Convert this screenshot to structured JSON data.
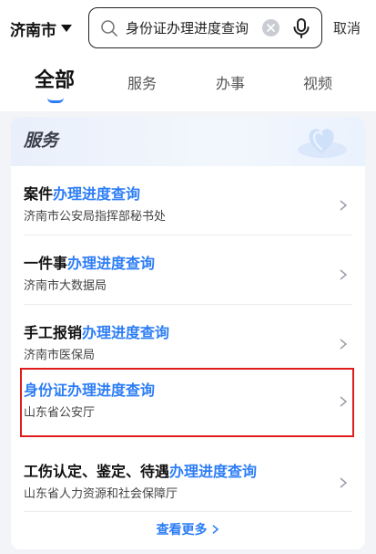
{
  "topbar": {
    "city": "济南市",
    "search_query": "身份证办理进度查询",
    "cancel_label": "取消"
  },
  "tabs": [
    {
      "label": "全部",
      "active": true
    },
    {
      "label": "服务",
      "active": false
    },
    {
      "label": "办事",
      "active": false
    },
    {
      "label": "视频",
      "active": false
    }
  ],
  "section": {
    "title": "服务",
    "items": [
      {
        "prefix": "案件",
        "highlight": "办理进度查询",
        "suffix": "",
        "department": "济南市公安局指挥部秘书处"
      },
      {
        "prefix": "一件事",
        "highlight": "办理进度查询",
        "suffix": "",
        "department": "济南市大数据局"
      },
      {
        "prefix": "手工报销",
        "highlight": "办理进度查询",
        "suffix": "",
        "department": "济南市医保局"
      },
      {
        "prefix": "",
        "highlight": "身份证办理进度查询",
        "suffix": "",
        "department": "山东省公安厅",
        "selected": true
      },
      {
        "prefix": "工伤认定、鉴定、待遇",
        "highlight": "办理进度查询",
        "suffix": "",
        "department": "山东省人力资源和社会保障厅"
      }
    ],
    "more_label": "查看更多"
  },
  "colors": {
    "accent": "#2d7df6",
    "selection_box": "#e01c1c"
  }
}
